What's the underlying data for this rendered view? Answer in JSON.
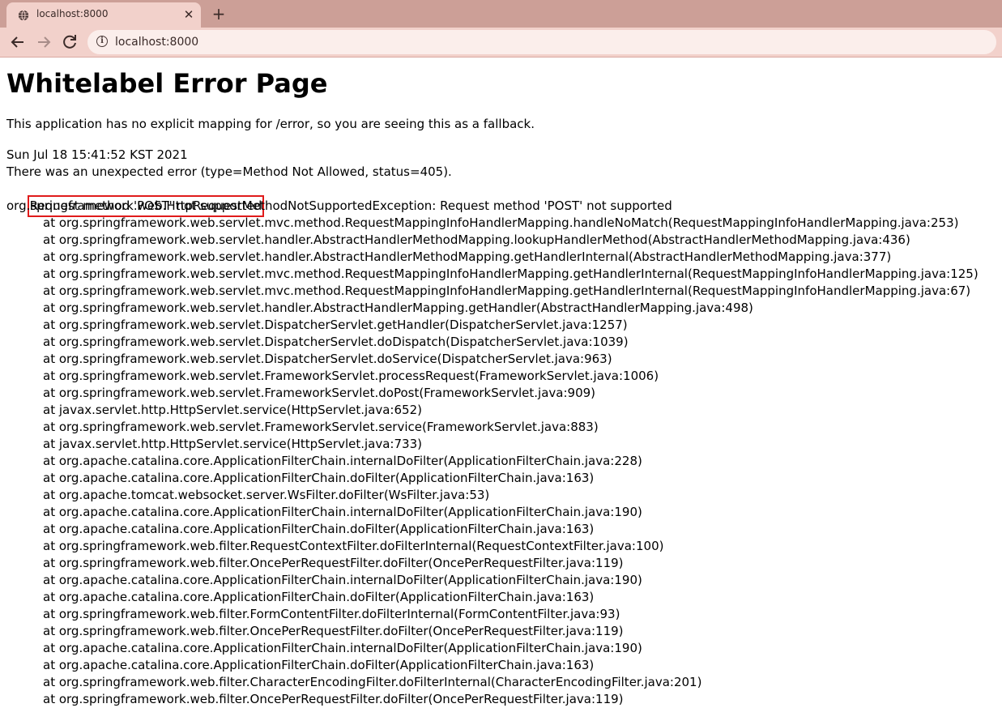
{
  "browser": {
    "tab_title": "localhost:8000",
    "tab_close": "✕",
    "new_tab": "+",
    "url": "localhost:8000",
    "info_icon": "i"
  },
  "page": {
    "heading": "Whitelabel Error Page",
    "description": "This application has no explicit mapping for /error, so you are seeing this as a fallback.",
    "timestamp": "Sun Jul 18 15:41:52 KST 2021",
    "error_line": "There was an unexpected error (type=Method Not Allowed, status=405).",
    "message": "Request method 'POST' not supported",
    "highlight_color": "#e01b1b",
    "exception": "org.springframework.web.HttpRequestMethodNotSupportedException: Request method 'POST' not supported",
    "stack_trace": [
      "at org.springframework.web.servlet.mvc.method.RequestMappingInfoHandlerMapping.handleNoMatch(RequestMappingInfoHandlerMapping.java:253)",
      "at org.springframework.web.servlet.handler.AbstractHandlerMethodMapping.lookupHandlerMethod(AbstractHandlerMethodMapping.java:436)",
      "at org.springframework.web.servlet.handler.AbstractHandlerMethodMapping.getHandlerInternal(AbstractHandlerMethodMapping.java:377)",
      "at org.springframework.web.servlet.mvc.method.RequestMappingInfoHandlerMapping.getHandlerInternal(RequestMappingInfoHandlerMapping.java:125)",
      "at org.springframework.web.servlet.mvc.method.RequestMappingInfoHandlerMapping.getHandlerInternal(RequestMappingInfoHandlerMapping.java:67)",
      "at org.springframework.web.servlet.handler.AbstractHandlerMapping.getHandler(AbstractHandlerMapping.java:498)",
      "at org.springframework.web.servlet.DispatcherServlet.getHandler(DispatcherServlet.java:1257)",
      "at org.springframework.web.servlet.DispatcherServlet.doDispatch(DispatcherServlet.java:1039)",
      "at org.springframework.web.servlet.DispatcherServlet.doService(DispatcherServlet.java:963)",
      "at org.springframework.web.servlet.FrameworkServlet.processRequest(FrameworkServlet.java:1006)",
      "at org.springframework.web.servlet.FrameworkServlet.doPost(FrameworkServlet.java:909)",
      "at javax.servlet.http.HttpServlet.service(HttpServlet.java:652)",
      "at org.springframework.web.servlet.FrameworkServlet.service(FrameworkServlet.java:883)",
      "at javax.servlet.http.HttpServlet.service(HttpServlet.java:733)",
      "at org.apache.catalina.core.ApplicationFilterChain.internalDoFilter(ApplicationFilterChain.java:228)",
      "at org.apache.catalina.core.ApplicationFilterChain.doFilter(ApplicationFilterChain.java:163)",
      "at org.apache.tomcat.websocket.server.WsFilter.doFilter(WsFilter.java:53)",
      "at org.apache.catalina.core.ApplicationFilterChain.internalDoFilter(ApplicationFilterChain.java:190)",
      "at org.apache.catalina.core.ApplicationFilterChain.doFilter(ApplicationFilterChain.java:163)",
      "at org.springframework.web.filter.RequestContextFilter.doFilterInternal(RequestContextFilter.java:100)",
      "at org.springframework.web.filter.OncePerRequestFilter.doFilter(OncePerRequestFilter.java:119)",
      "at org.apache.catalina.core.ApplicationFilterChain.internalDoFilter(ApplicationFilterChain.java:190)",
      "at org.apache.catalina.core.ApplicationFilterChain.doFilter(ApplicationFilterChain.java:163)",
      "at org.springframework.web.filter.FormContentFilter.doFilterInternal(FormContentFilter.java:93)",
      "at org.springframework.web.filter.OncePerRequestFilter.doFilter(OncePerRequestFilter.java:119)",
      "at org.apache.catalina.core.ApplicationFilterChain.internalDoFilter(ApplicationFilterChain.java:190)",
      "at org.apache.catalina.core.ApplicationFilterChain.doFilter(ApplicationFilterChain.java:163)",
      "at org.springframework.web.filter.CharacterEncodingFilter.doFilterInternal(CharacterEncodingFilter.java:201)",
      "at org.springframework.web.filter.OncePerRequestFilter.doFilter(OncePerRequestFilter.java:119)"
    ]
  }
}
